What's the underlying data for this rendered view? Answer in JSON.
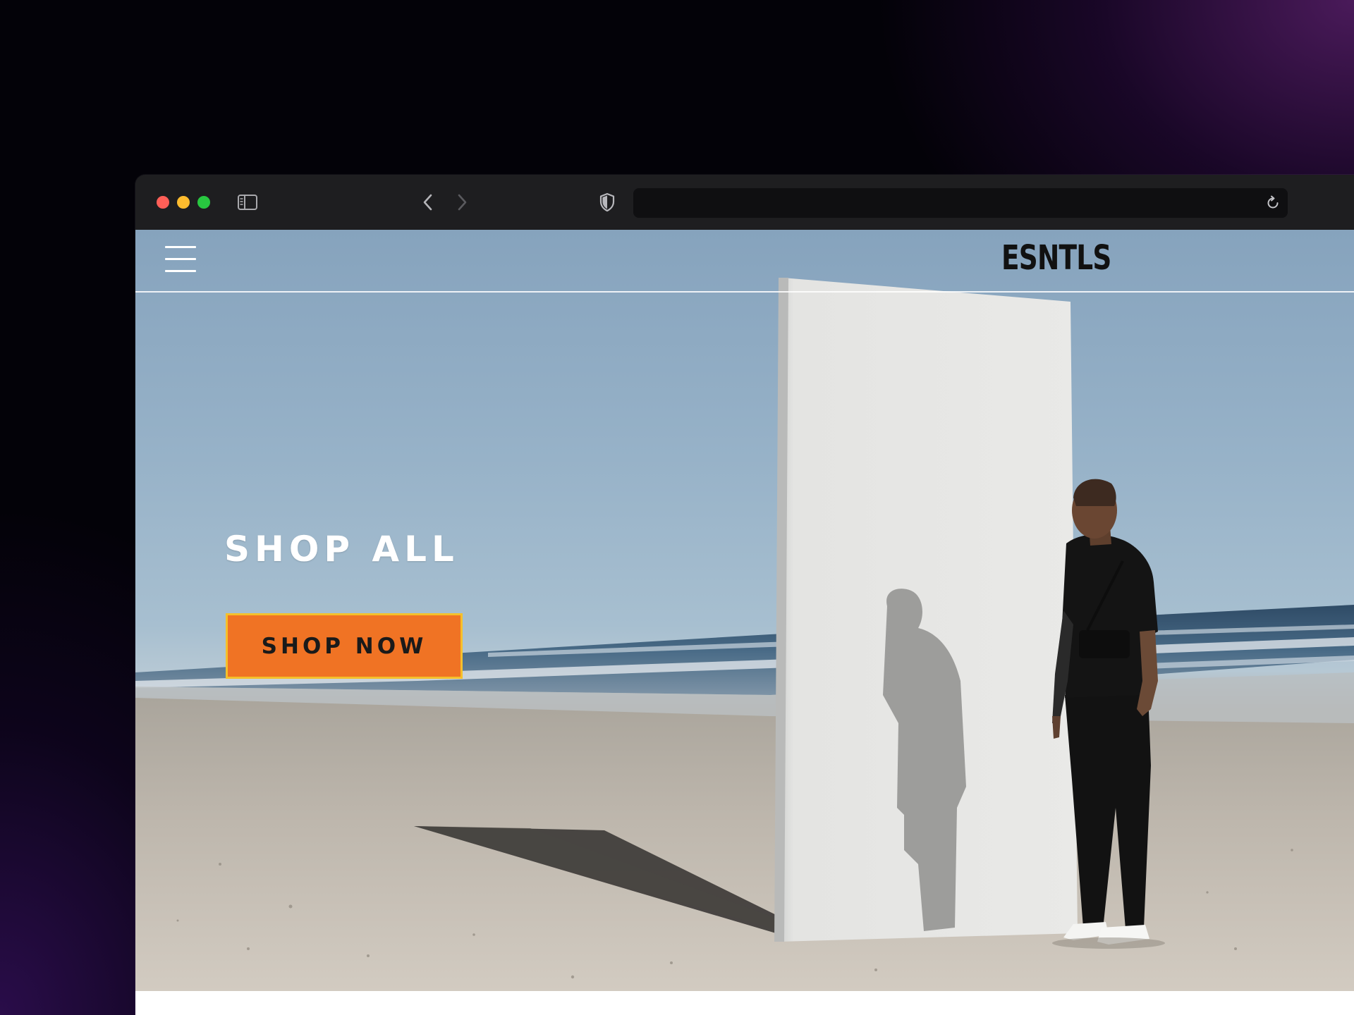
{
  "browser": {
    "address_bar": {
      "url": ""
    }
  },
  "site": {
    "brand": "ESNTLS",
    "hero": {
      "title": "SHOP ALL",
      "cta_label": "SHOP NOW"
    }
  },
  "colors": {
    "cta_background": "#f07324",
    "cta_border": "#f5c02b",
    "brand_text": "#111111"
  },
  "icons": {
    "menu": "hamburger-menu-icon",
    "sidebar": "sidebar-toggle-icon",
    "back": "chevron-left-icon",
    "forward": "chevron-right-icon",
    "privacy": "shield-icon",
    "reload": "reload-icon"
  }
}
